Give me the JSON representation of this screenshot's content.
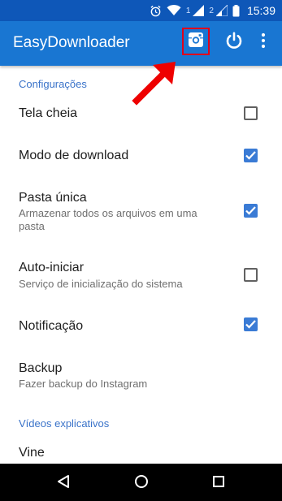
{
  "status_bar": {
    "time": "15:39",
    "sim1": "1",
    "sim2": "2",
    "icons": [
      "alarm-icon",
      "wifi-icon",
      "signal-icon",
      "signal-icon",
      "battery-icon"
    ]
  },
  "toolbar": {
    "title": "EasyDownloader",
    "actions": [
      "instagram-icon",
      "power-icon",
      "more-vert-icon"
    ]
  },
  "settings": {
    "section_configuracoes": "Configurações",
    "items": [
      {
        "title": "Tela cheia",
        "subtitle": "",
        "checked": false
      },
      {
        "title": "Modo de download",
        "subtitle": "",
        "checked": true
      },
      {
        "title": "Pasta única",
        "subtitle": "Armazenar todos os arquivos em uma pasta",
        "checked": true
      },
      {
        "title": "Auto-iniciar",
        "subtitle": "Serviço de inicialização do sistema",
        "checked": false
      },
      {
        "title": "Notificação",
        "subtitle": "",
        "checked": true
      },
      {
        "title": "Backup",
        "subtitle": "Fazer backup do Instagram",
        "checked": null
      }
    ],
    "section_videos": "Vídeos explicativos",
    "videos": [
      {
        "title": "Vine"
      }
    ]
  },
  "colors": {
    "status_bar": "#0e57b8",
    "toolbar": "#1976d2",
    "accent": "#3a7bd5",
    "highlight_box": "#e0001b",
    "arrow": "#ee0000"
  },
  "nav_bar": {
    "buttons": [
      "back-icon",
      "home-icon",
      "recents-icon"
    ]
  }
}
